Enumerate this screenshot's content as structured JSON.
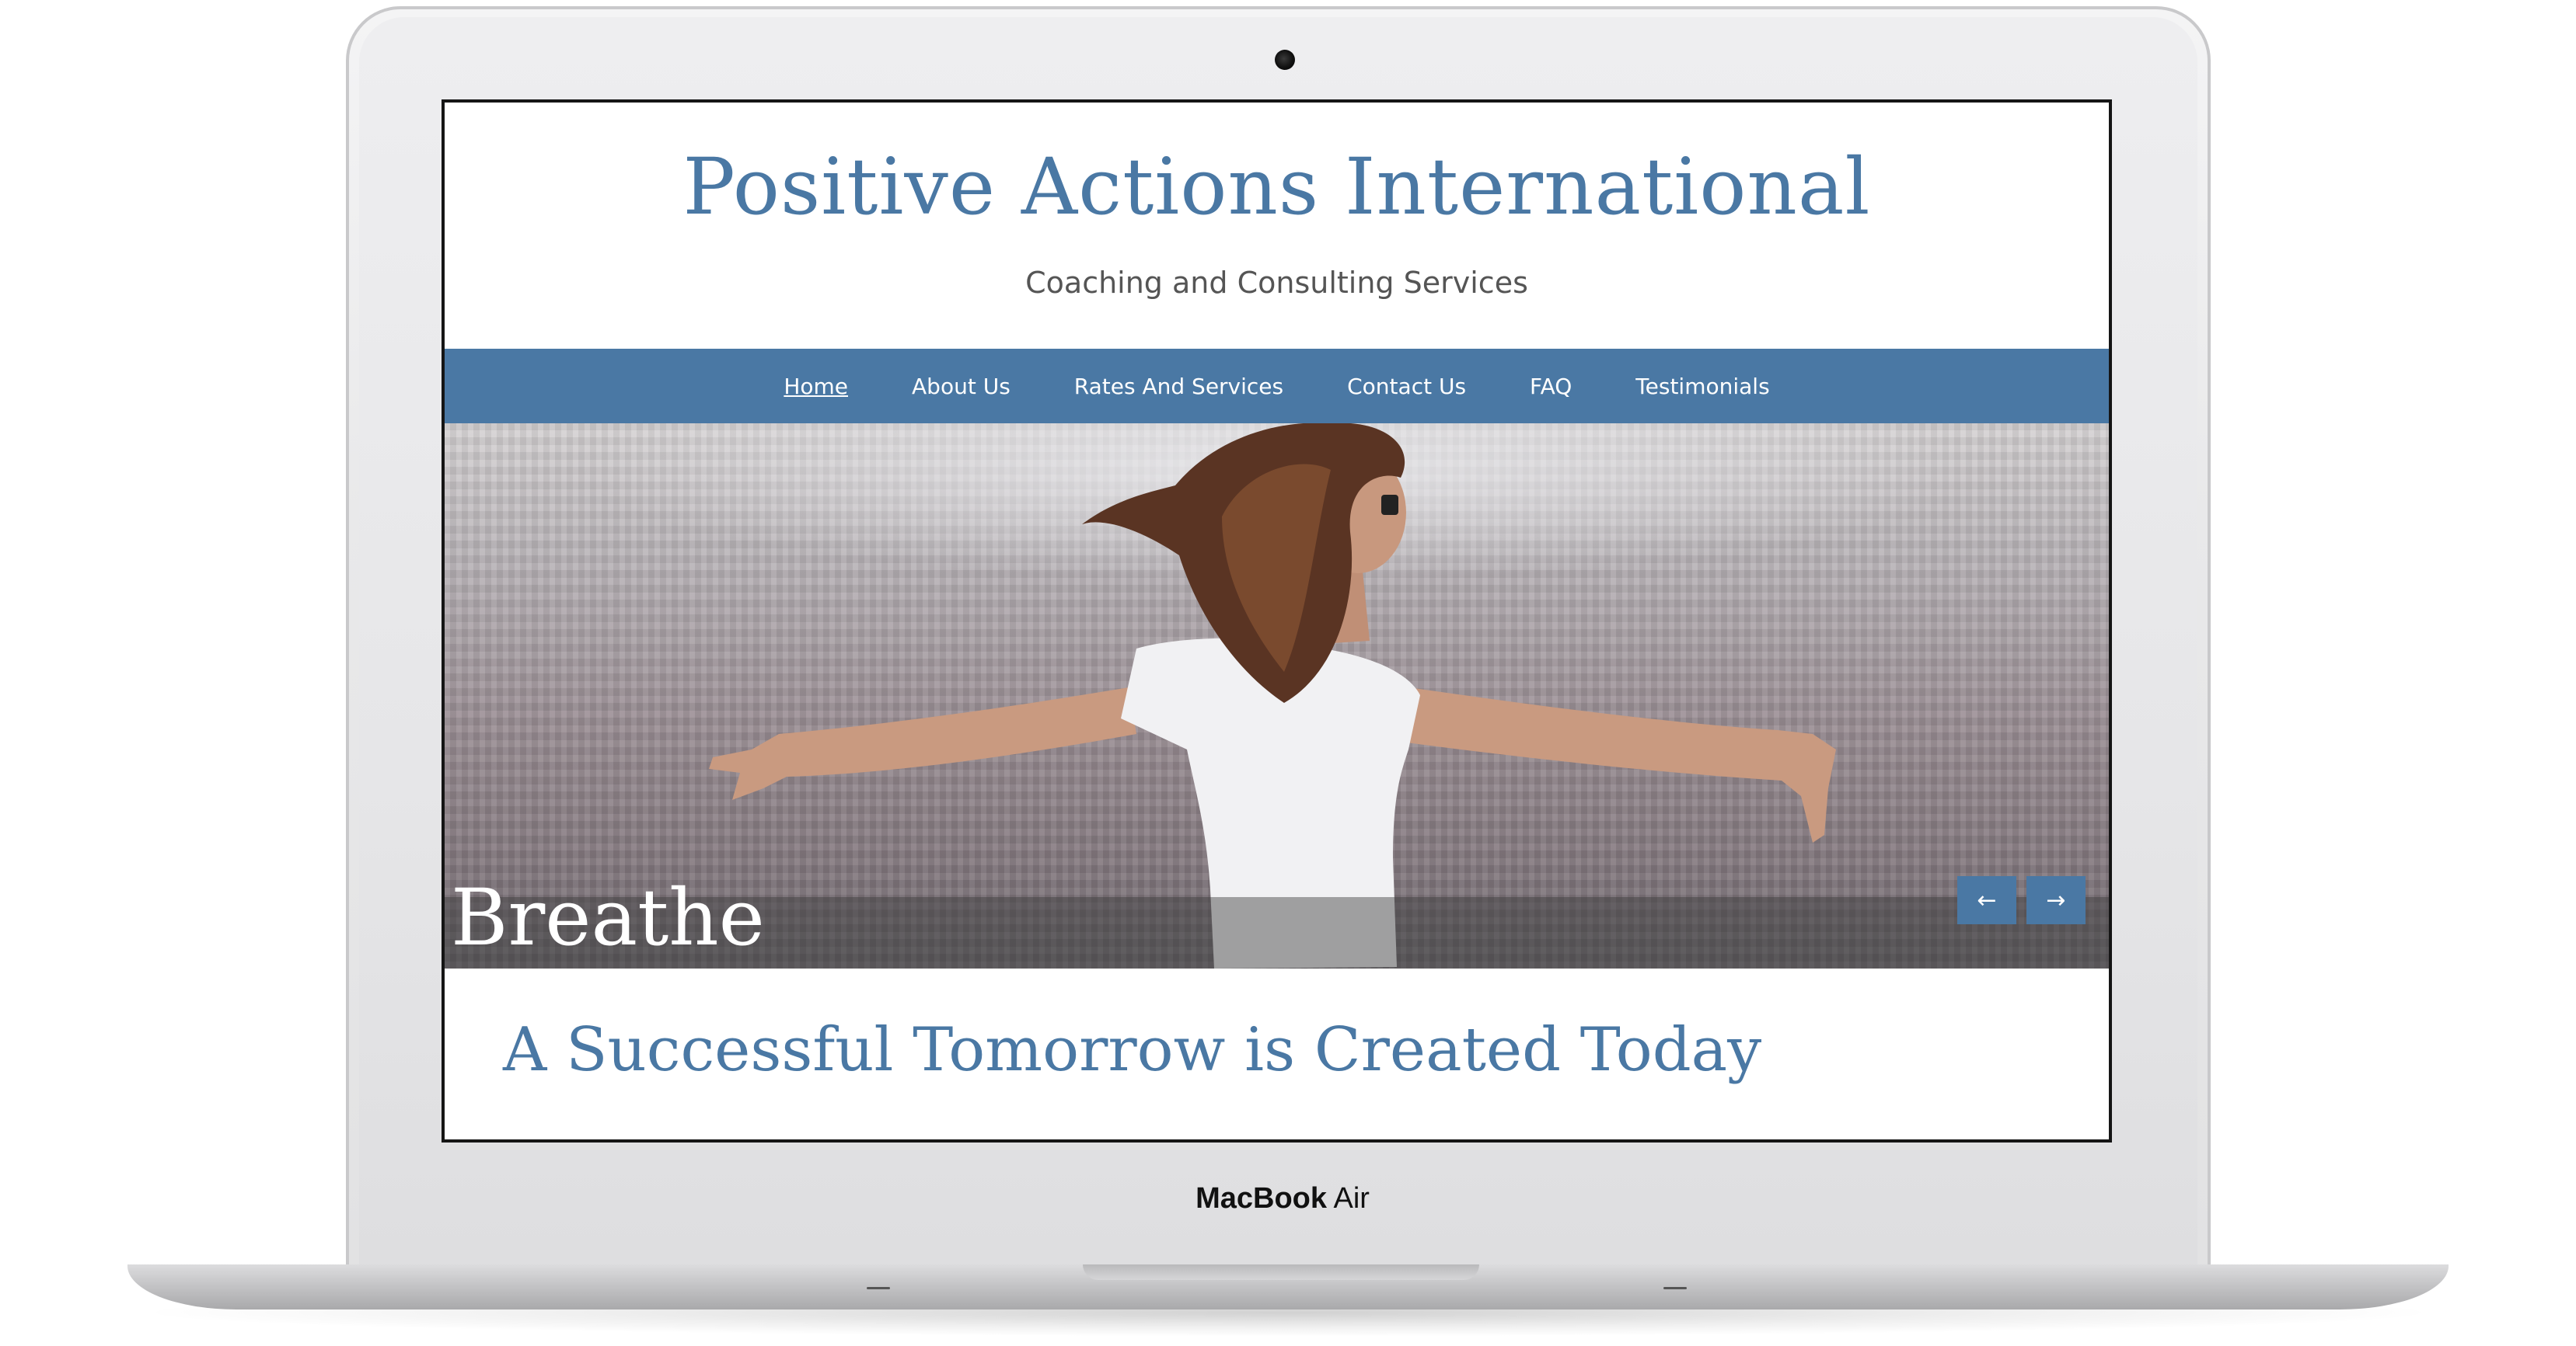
{
  "device": {
    "brand_bold": "MacBook",
    "brand_light": "Air"
  },
  "site": {
    "title": "Positive Actions International",
    "tagline": "Coaching and Consulting Services",
    "accent_color": "#4a78a4"
  },
  "nav": {
    "items": [
      {
        "label": "Home",
        "active": true
      },
      {
        "label": "About Us"
      },
      {
        "label": "Rates And Services"
      },
      {
        "label": "Contact Us"
      },
      {
        "label": "FAQ"
      },
      {
        "label": "Testimonials"
      }
    ]
  },
  "slider": {
    "caption": "Breathe",
    "prev_label": "←",
    "next_label": "→",
    "image": "woman-arms-outstretched-over-city"
  },
  "main": {
    "headline": "A Successful Tomorrow is Created Today"
  }
}
